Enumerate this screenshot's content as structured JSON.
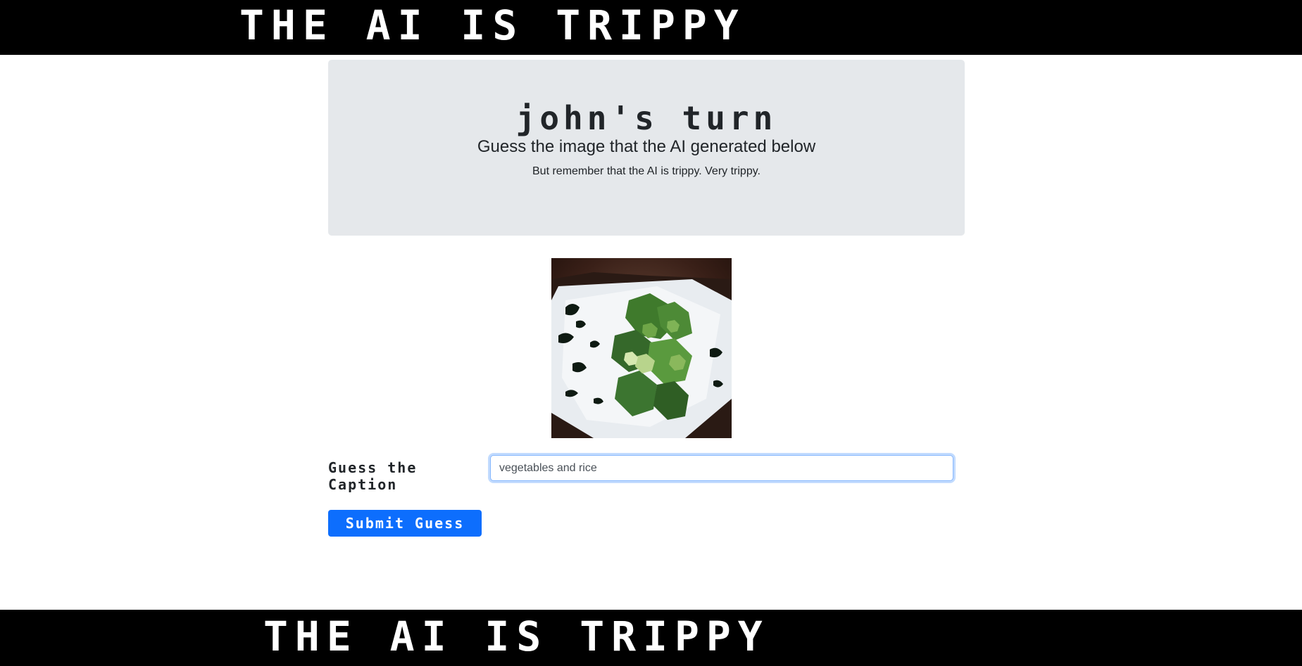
{
  "header": {
    "title": "THE AI IS TRIPPY"
  },
  "jumbotron": {
    "turn_title": "john's turn",
    "lead": "Guess the image that the AI generated below",
    "subtext": "But remember that the AI is trippy. Very trippy."
  },
  "form": {
    "label": "Guess the Caption",
    "input_value": "vegetables and rice",
    "submit_label": "Submit Guess"
  },
  "footer": {
    "title": "THE AI IS TRIPPY"
  },
  "colors": {
    "bar": "#000000",
    "jumbotron_bg": "#e5e8eb",
    "button": "#0d6efd"
  }
}
